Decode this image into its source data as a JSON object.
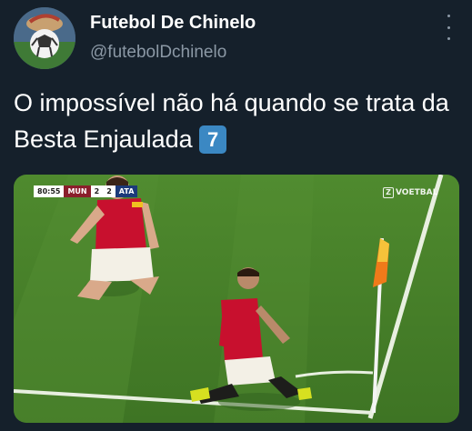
{
  "author": {
    "name": "Futebol De Chinelo",
    "handle": "@futebolDchinelo"
  },
  "tweet": {
    "text": "O impossível não há quando se trata da Besta Enjaulada",
    "emoji": "7"
  },
  "media": {
    "scoreboard": {
      "time": "80:55",
      "home": "MUN",
      "home_score": "2",
      "away_score": "2",
      "away": "ATA"
    },
    "watermark": "VOETBAL"
  },
  "colors": {
    "background": "#15202b",
    "secondary_text": "#8b98a5",
    "keycap": "#3b88c3"
  },
  "icons": [
    "avatar-image",
    "more-options-icon",
    "keycap-seven-emoji"
  ]
}
